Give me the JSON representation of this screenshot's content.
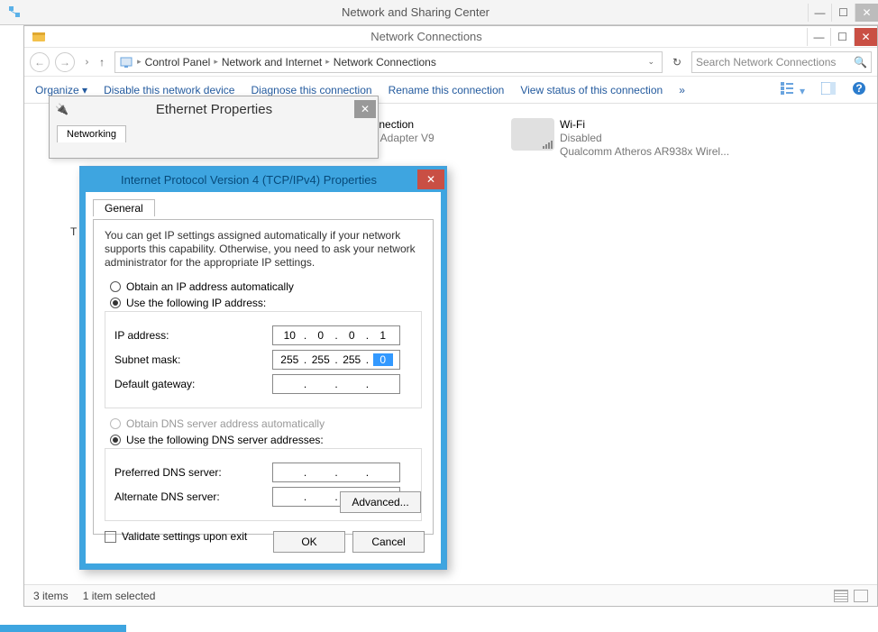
{
  "outer": {
    "title": "Network and Sharing Center"
  },
  "inner": {
    "title": "Network Connections",
    "breadcrumb": [
      "Control Panel",
      "Network and Internet",
      "Network Connections"
    ],
    "searchPlaceholder": "Search Network Connections"
  },
  "cmdbar": {
    "organize": "Organize",
    "disable": "Disable this network device",
    "diagnose": "Diagnose this connection",
    "rename": "Rename this connection",
    "viewstatus": "View status of this connection",
    "more": "»"
  },
  "netitems": {
    "item1": {
      "line1": "onnection",
      "line2": "vs Adapter V9"
    },
    "item2": {
      "line1": "Wi-Fi",
      "line2": "Disabled",
      "line3": "Qualcomm Atheros AR938x Wirel..."
    }
  },
  "ethprops": {
    "title": "Ethernet Properties",
    "tab": "Networking",
    "partial": "T"
  },
  "ipv4": {
    "title": "Internet Protocol Version 4 (TCP/IPv4) Properties",
    "tab": "General",
    "desc": "You can get IP settings assigned automatically if your network supports this capability. Otherwise, you need to ask your network administrator for the appropriate IP settings.",
    "radio_obtain_ip": "Obtain an IP address automatically",
    "radio_use_ip": "Use the following IP address:",
    "lbl_ipaddr": "IP address:",
    "lbl_subnet": "Subnet mask:",
    "lbl_gw": "Default gateway:",
    "ip": {
      "o1": "10",
      "o2": "0",
      "o3": "0",
      "o4": "1"
    },
    "mask": {
      "o1": "255",
      "o2": "255",
      "o3": "255",
      "o4": "0"
    },
    "radio_obtain_dns": "Obtain DNS server address automatically",
    "radio_use_dns": "Use the following DNS server addresses:",
    "lbl_pdns": "Preferred DNS server:",
    "lbl_adns": "Alternate DNS server:",
    "validate": "Validate settings upon exit",
    "advanced": "Advanced...",
    "ok": "OK",
    "cancel": "Cancel"
  },
  "status": {
    "items": "3 items",
    "sel": "1 item selected"
  }
}
